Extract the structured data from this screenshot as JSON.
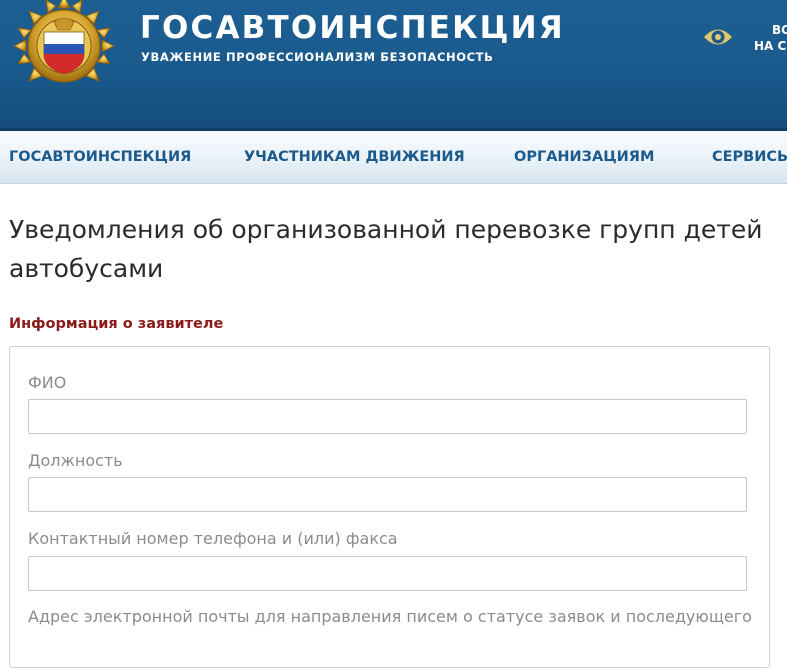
{
  "header": {
    "brand_title": "ГОСАВТОИНСПЕКЦИЯ",
    "brand_tagline": "УВАЖЕНИЕ ПРОФЕССИОНАЛИЗМ БЕЗОПАСНОСТЬ",
    "vision_mode_line1": "ВО",
    "vision_mode_line2": "НА С"
  },
  "nav": {
    "items": [
      {
        "label": "ГОСАВТОИНСПЕКЦИЯ"
      },
      {
        "label": "УЧАСТНИКАМ ДВИЖЕНИЯ"
      },
      {
        "label": "ОРГАНИЗАЦИЯМ"
      },
      {
        "label": "СЕРВИСЫ"
      }
    ]
  },
  "page": {
    "title": "Уведомления об организованной перевозке групп детей автобусами"
  },
  "form": {
    "section_title": "Информация о заявителе",
    "fields": [
      {
        "label": "ФИО",
        "value": ""
      },
      {
        "label": "Должность",
        "value": ""
      },
      {
        "label": "Контактный номер телефона и (или) факса",
        "value": ""
      },
      {
        "label": "Адрес электронной почты для направления писем о статусе заявок и последующего",
        "value": ""
      }
    ]
  },
  "colors": {
    "header_blue": "#1a5a8d",
    "nav_text": "#1b5a8c",
    "section_title": "#8b1a1a",
    "label_gray": "#8c8c8c"
  }
}
